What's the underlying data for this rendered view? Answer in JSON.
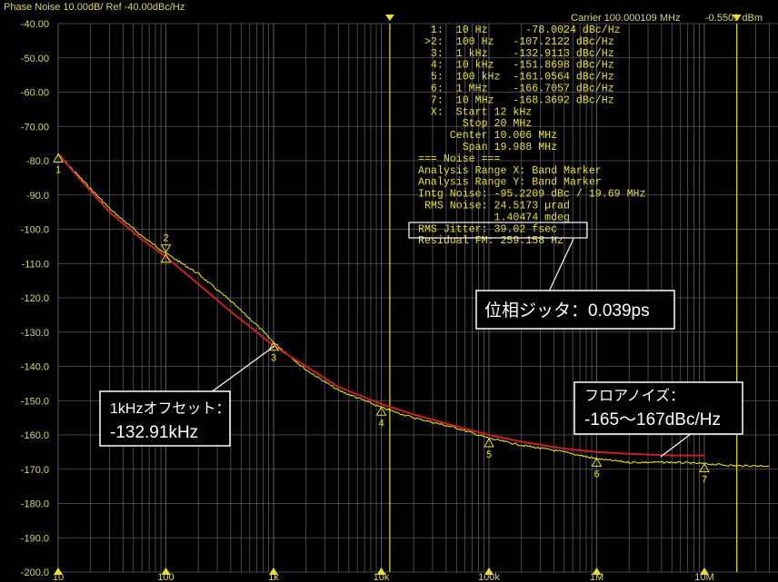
{
  "header": {
    "title": "Phase Noise 10.00dB/ Ref -40.00dBc/Hz",
    "carrier": "Carrier 100.000109 MHz",
    "power": "-0.5509 dBm"
  },
  "y_axis": {
    "ticks": [
      "-40.00",
      "-50.00",
      "-60.00",
      "-70.00",
      "-80.0",
      "-90.0",
      "-100.0",
      "-110.0",
      "-120.0",
      "-130.0",
      "-140.0",
      "-150.0",
      "-160.0",
      "-170.0",
      "-180.0",
      "-190.0",
      "-200.0"
    ]
  },
  "x_axis": {
    "labels": [
      "10",
      "100",
      "1k",
      "10k",
      "100k",
      "1M",
      "10M"
    ]
  },
  "markers": [
    {
      "label": "1",
      "freq_hz": 10,
      "dbc": -78.0024
    },
    {
      "label": "2",
      "freq_hz": 100,
      "dbc": -107.2122
    },
    {
      "label": "3",
      "freq_hz": 1000,
      "dbc": -132.9113
    },
    {
      "label": "4",
      "freq_hz": 10000,
      "dbc": -151.8698
    },
    {
      "label": "5",
      "freq_hz": 100000,
      "dbc": -161.0564
    },
    {
      "label": "6",
      "freq_hz": 1000000,
      "dbc": -166.7057
    },
    {
      "label": "7",
      "freq_hz": 10000000,
      "dbc": -168.3692
    }
  ],
  "marker_table": [
    "  1:  10 Hz      -78.0024 dBc/Hz",
    " >2:  100 Hz   -107.2122 dBc/Hz",
    "  3:  1 kHz    -132.9113 dBc/Hz",
    "  4:  10 kHz   -151.8698 dBc/Hz",
    "  5:  100 kHz  -161.0564 dBc/Hz",
    "  6:  1 MHz    -166.7057 dBc/Hz",
    "  7:  10 MHz   -168.3692 dBc/Hz",
    "  X:  Start 12 kHz",
    "       Stop 20 MHz",
    "     Center 10.006 MHz",
    "       Span 19.988 MHz",
    "=== Noise ===",
    "Analysis Range X: Band Marker",
    "Analysis Range Y: Band Marker",
    "Intg Noise: -95.2209 dBc / 19.69 MHz",
    " RMS Noise: 24.5173 µrad",
    "            1.40474 mdeg",
    "RMS Jitter: 39.02 fsec",
    "Residual FM: 259.158 Hz"
  ],
  "callouts": {
    "jitter": "位相ジッタ：0.039ps",
    "offset_line1": "1kHzオフセット：",
    "offset_line2": "-132.91kHz",
    "floor_line1": "フロアノイズ：",
    "floor_line2": "-165〜167dBc/Hz"
  },
  "colors": {
    "background": "#000000",
    "grid": "#5a5a5a",
    "text": "#e8e030",
    "trace": "#f0f000",
    "smoothed": "#c8202a",
    "band_marker": "#e8e030",
    "callout_box": "#ffffff"
  },
  "chart_data": {
    "type": "line",
    "xscale": "log",
    "xlim": [
      10,
      40000000
    ],
    "ylim": [
      -200,
      -40
    ],
    "series": [
      {
        "x": [
          10,
          15,
          30,
          60,
          100,
          200,
          400,
          700,
          1000,
          2000,
          4000,
          7000,
          10000,
          20000,
          50000,
          100000,
          200000,
          500000,
          1000000,
          2000000,
          5000000,
          10000000,
          20000000,
          40000000
        ],
        "y": [
          -78,
          -84,
          -94,
          -102,
          -107,
          -113,
          -121,
          -128,
          -133,
          -141,
          -147,
          -150,
          -152,
          -155,
          -158,
          -161,
          -163,
          -165,
          -167,
          -168,
          -168,
          -168.4,
          -169,
          -169
        ]
      },
      {
        "x": [
          10,
          15,
          30,
          60,
          100,
          200,
          400,
          700,
          1000,
          2000,
          4000,
          7000,
          10000,
          20000,
          50000,
          100000,
          200000,
          500000,
          1000000,
          2000000,
          5000000,
          10000000
        ],
        "y": [
          -78,
          -84.5,
          -95,
          -103,
          -108,
          -116,
          -124,
          -130,
          -134,
          -140,
          -146,
          -149,
          -151,
          -154,
          -157.5,
          -160,
          -162,
          -164,
          -165,
          -165.5,
          -166,
          -166
        ]
      }
    ],
    "band_markers_hz": [
      12000,
      20000000
    ]
  }
}
